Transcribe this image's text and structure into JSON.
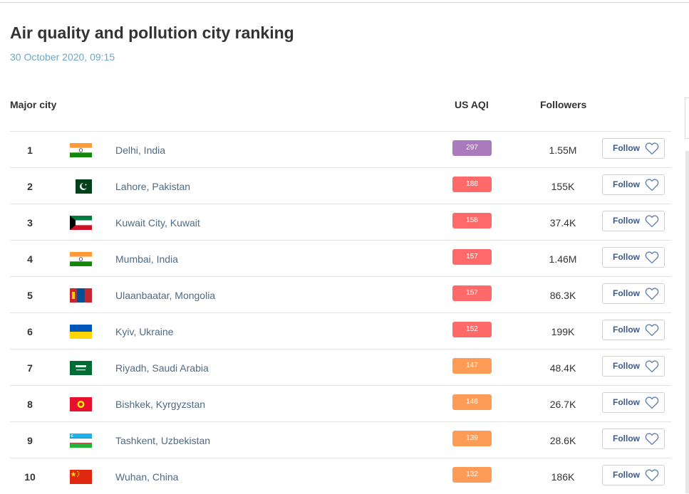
{
  "page": {
    "title": "Air quality and pollution city ranking",
    "timestamp": "30 October 2020, 09:15"
  },
  "table": {
    "headers": {
      "city": "Major city",
      "aqi": "US AQI",
      "followers": "Followers"
    },
    "follow_label": "Follow",
    "rows": [
      {
        "rank": "1",
        "city": "Delhi, India",
        "aqi": "297",
        "followers": "1.55M",
        "flag": "india-flag",
        "aqi_color": "#a97abc"
      },
      {
        "rank": "2",
        "city": "Lahore, Pakistan",
        "aqi": "188",
        "followers": "155K",
        "flag": "pakistan-flag",
        "aqi_color": "#fe6a69"
      },
      {
        "rank": "3",
        "city": "Kuwait City, Kuwait",
        "aqi": "158",
        "followers": "37.4K",
        "flag": "kuwait-flag",
        "aqi_color": "#fe6a69"
      },
      {
        "rank": "4",
        "city": "Mumbai, India",
        "aqi": "157",
        "followers": "1.46M",
        "flag": "india-flag",
        "aqi_color": "#fe6a69"
      },
      {
        "rank": "5",
        "city": "Ulaanbaatar, Mongolia",
        "aqi": "157",
        "followers": "86.3K",
        "flag": "mongolia-flag",
        "aqi_color": "#fe6a69"
      },
      {
        "rank": "6",
        "city": "Kyiv, Ukraine",
        "aqi": "152",
        "followers": "199K",
        "flag": "ukraine-flag",
        "aqi_color": "#fe6a69"
      },
      {
        "rank": "7",
        "city": "Riyadh, Saudi Arabia",
        "aqi": "147",
        "followers": "48.4K",
        "flag": "saudi-arabia-flag",
        "aqi_color": "#fe9b57"
      },
      {
        "rank": "8",
        "city": "Bishkek, Kyrgyzstan",
        "aqi": "146",
        "followers": "26.7K",
        "flag": "kyrgyzstan-flag",
        "aqi_color": "#fe9b57"
      },
      {
        "rank": "9",
        "city": "Tashkent, Uzbekistan",
        "aqi": "139",
        "followers": "28.6K",
        "flag": "uzbekistan-flag",
        "aqi_color": "#fe9b57"
      },
      {
        "rank": "10",
        "city": "Wuhan, China",
        "aqi": "132",
        "followers": "186K",
        "flag": "china-flag",
        "aqi_color": "#fe9b57"
      }
    ]
  }
}
